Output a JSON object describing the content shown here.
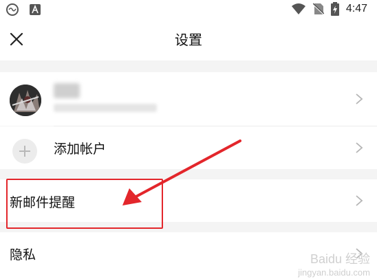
{
  "status_bar": {
    "time": "4:47",
    "icons": [
      "avatar-status-icon",
      "notification-a-icon",
      "wifi-icon",
      "no-sim-icon",
      "battery-charging-icon"
    ]
  },
  "header": {
    "title": "设置",
    "close_icon": "close-icon"
  },
  "account": {
    "name_visible": "刘",
    "email": "",
    "chevron": "chevron-right-icon"
  },
  "add_account": {
    "label": "添加帐户",
    "icon": "plus-icon"
  },
  "settings_items": [
    {
      "label": "新邮件提醒"
    },
    {
      "label": "隐私"
    }
  ],
  "annotation": {
    "box_color": "#e3262b",
    "arrow_color": "#e3262b"
  },
  "watermark": {
    "brand": "Baidu 经验",
    "url": "jingyan.baidu.com"
  }
}
